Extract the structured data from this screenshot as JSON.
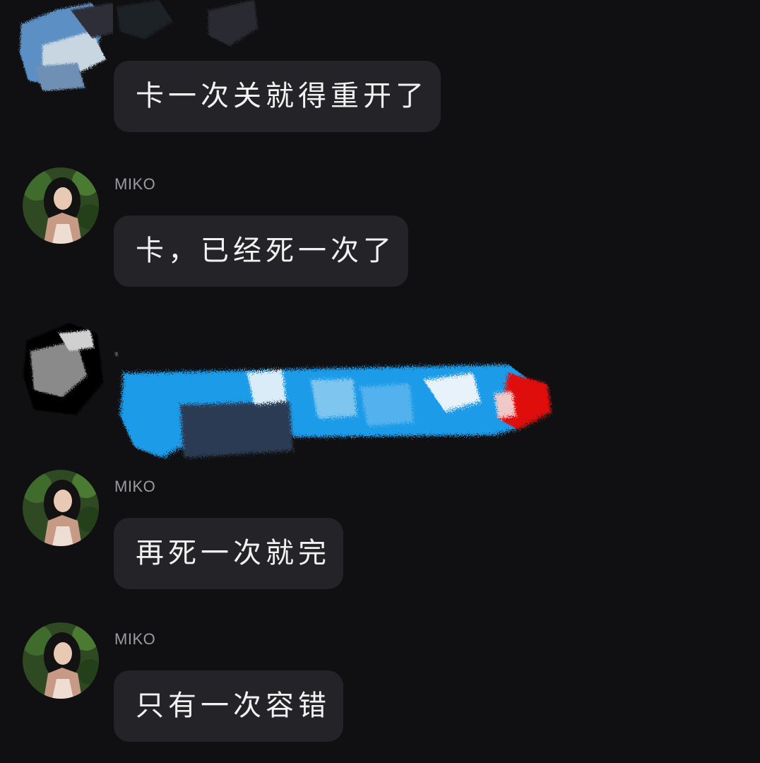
{
  "messages": [
    {
      "avatar": "redacted-avatar",
      "sender": "",
      "text": "卡一次关就得重开了"
    },
    {
      "avatar": "miko-avatar",
      "sender": "MIKO",
      "text": "卡，已经死一次了"
    },
    {
      "avatar": "redacted-avatar",
      "sender": "",
      "text": ""
    },
    {
      "avatar": "miko-avatar",
      "sender": "MIKO",
      "text": "再死一次就完"
    },
    {
      "avatar": "miko-avatar",
      "sender": "MIKO",
      "text": "只有一次容错"
    }
  ],
  "colors": {
    "background": "#101013",
    "bubble": "#242428",
    "sender": "#9a9aa2",
    "text": "#f2f2f2",
    "redaction_blue": "#1e9be8",
    "redaction_red": "#e01010"
  }
}
